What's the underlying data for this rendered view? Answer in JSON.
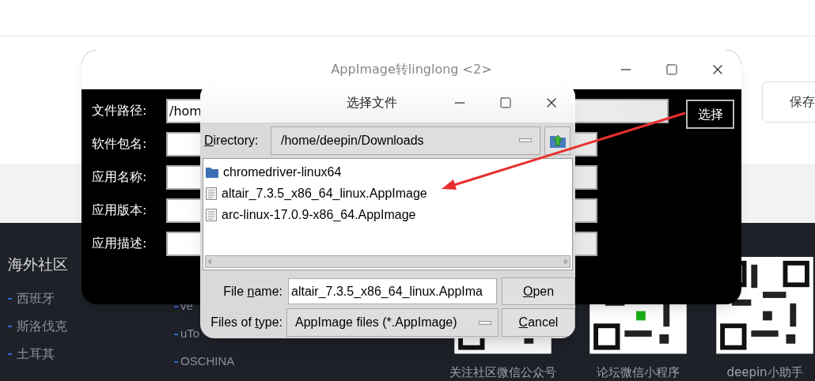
{
  "page": {
    "save_button": "保存",
    "footer": {
      "heading": "海外社区",
      "links_col1": [
        "西班牙",
        "斯洛伐克",
        "土耳其"
      ],
      "links_col2": [
        "ve",
        "uTo",
        "OSCHINA"
      ],
      "qr_codes": [
        {
          "caption": "关注社区微信公众号"
        },
        {
          "caption": "论坛微信小程序"
        },
        {
          "caption": "deepin小助手"
        }
      ]
    }
  },
  "app_window": {
    "title": "AppImage转linglong <2>",
    "fields": [
      {
        "label": "文件路径:",
        "value": "/hom"
      },
      {
        "label": "软件包名:"
      },
      {
        "label": "应用名称:"
      },
      {
        "label": "应用版本:"
      },
      {
        "label": "应用描述:"
      }
    ],
    "choose_button": "选择"
  },
  "file_dialog": {
    "title": "选择文件",
    "directory": {
      "label": {
        "key": "D",
        "post": "irectory:"
      },
      "value": "/home/deepin/Downloads"
    },
    "files": [
      {
        "kind": "folder",
        "name": "chromedriver-linux64"
      },
      {
        "kind": "file",
        "name": "altair_7.3.5_x86_64_linux.AppImage"
      },
      {
        "kind": "file",
        "name": "arc-linux-17.0.9-x86_64.AppImage"
      }
    ],
    "file_name": {
      "label": {
        "pre": "File ",
        "key": "n",
        "post": "ame:"
      },
      "value": "altair_7.3.5_x86_64_linux.AppIma"
    },
    "file_type": {
      "label": {
        "pre": "Files of ",
        "key": "t",
        "post": "ype:"
      },
      "value": "AppImage files (*.AppImage)"
    },
    "buttons": [
      {
        "key": "O",
        "post": "pen"
      },
      {
        "key": "C",
        "post": "ancel"
      }
    ]
  }
}
